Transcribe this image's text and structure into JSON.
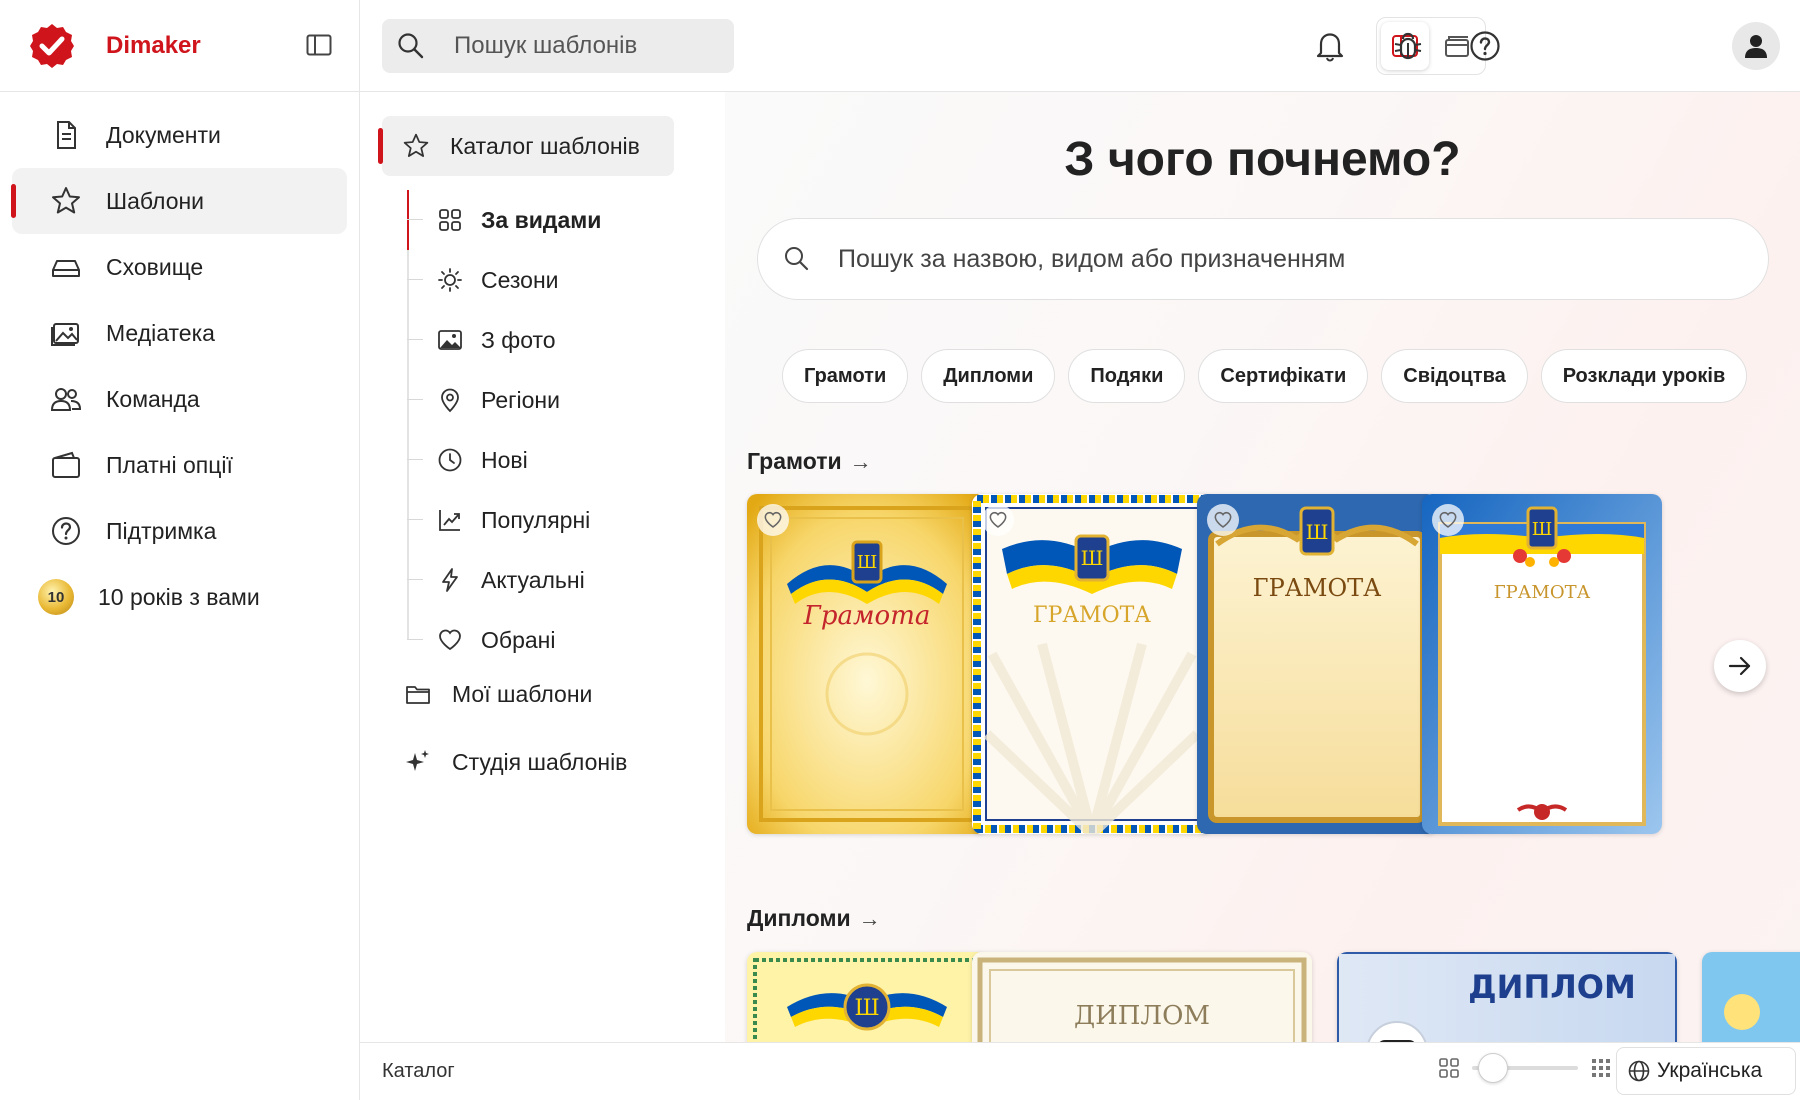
{
  "app": {
    "name": "Dimaker"
  },
  "sidebar": {
    "items": [
      {
        "label": "Документи",
        "icon": "document-icon",
        "active": false
      },
      {
        "label": "Шаблони",
        "icon": "star-icon",
        "active": true
      },
      {
        "label": "Сховище",
        "icon": "drive-icon",
        "active": false
      },
      {
        "label": "Медіатека",
        "icon": "image-library-icon",
        "active": false
      },
      {
        "label": "Команда",
        "icon": "team-icon",
        "active": false
      },
      {
        "label": "Платні опції",
        "icon": "wallet-icon",
        "active": false
      },
      {
        "label": "Підтримка",
        "icon": "help-icon",
        "active": false
      }
    ],
    "anniversary": {
      "badge": "10",
      "label": "10 років з вами"
    }
  },
  "topbar": {
    "search_placeholder": "Пошук шаблонів"
  },
  "catalog": {
    "header": "Каталог шаблонів",
    "subitems": [
      {
        "label": "За видами",
        "icon": "grid-icon",
        "bold": true
      },
      {
        "label": "Сезони",
        "icon": "sun-icon",
        "bold": false
      },
      {
        "label": "З фото",
        "icon": "photo-icon",
        "bold": false
      },
      {
        "label": "Регіони",
        "icon": "location-pin-icon",
        "bold": false
      },
      {
        "label": "Нові",
        "icon": "clock-icon",
        "bold": false
      },
      {
        "label": "Популярні",
        "icon": "trending-icon",
        "bold": false
      },
      {
        "label": "Актуальні",
        "icon": "lightning-icon",
        "bold": false
      },
      {
        "label": "Обрані",
        "icon": "heart-icon",
        "bold": false
      }
    ],
    "my_templates": "Мої шаблони",
    "studio": "Студія шаблонів"
  },
  "main": {
    "title": "З чого почнемо?",
    "search_placeholder": "Пошук за назвою, видом або призначенням",
    "chips": [
      "Грамоти",
      "Дипломи",
      "Подяки",
      "Сертифікати",
      "Свідоцтва",
      "Розклади уроків"
    ],
    "sections": [
      {
        "title": "Грамоти",
        "cards": [
          {
            "caption": "Грамота",
            "style": "gold"
          },
          {
            "caption": "ГРАМОТА",
            "style": "rays"
          },
          {
            "caption": "ГРАМОТА",
            "style": "blue-frame"
          },
          {
            "caption": "ГРАМОТА",
            "style": "flowers"
          }
        ]
      },
      {
        "title": "Дипломи",
        "cards": [
          {
            "caption": "",
            "style": "yellow"
          },
          {
            "caption": "ДИПЛОМ",
            "style": "classic"
          },
          {
            "caption": "ДИПЛОМ",
            "style": "robot"
          }
        ]
      }
    ]
  },
  "footer": {
    "label": "Каталог",
    "zoom_level": 0.2,
    "language": "Українська"
  },
  "colors": {
    "brand": "#d0141c",
    "ukraine_blue": "#0057b7",
    "ukraine_yellow": "#ffd700"
  }
}
